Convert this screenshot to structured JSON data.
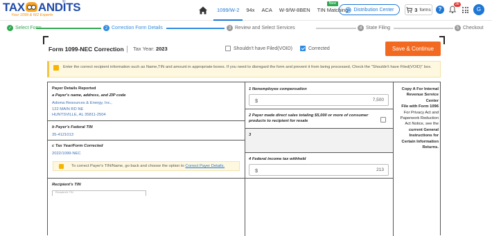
{
  "header": {
    "logo_text_left": "TAX",
    "logo_text_right": "ANDITS",
    "logo_reg": "®",
    "logo_tagline": "Your 1099 & W2 Experts",
    "nav": [
      {
        "label": "1099/W-2",
        "active": true
      },
      {
        "label": "94x"
      },
      {
        "label": "ACA"
      },
      {
        "label": "W-9/W-8BEN"
      },
      {
        "label": "TIN Matching",
        "badge": "New"
      }
    ],
    "distribution_label": "Distribution Center",
    "cart_count": "3",
    "cart_label": "forms",
    "help_label": "?",
    "bell_count": "36",
    "avatar_initial": "G"
  },
  "stepper": [
    {
      "num": "✓",
      "label": "Select Form",
      "state": "done"
    },
    {
      "num": "2",
      "label": "Correction Form Details",
      "state": "current"
    },
    {
      "num": "3",
      "label": "Review and Select Services",
      "state": "todo"
    },
    {
      "num": "4",
      "label": "State Filing",
      "state": "todo"
    },
    {
      "num": "5",
      "label": "Checkout",
      "state": "todo"
    }
  ],
  "form": {
    "title": "Form 1099-NEC Correction",
    "tax_year_label": "Tax Year:",
    "tax_year": "2023",
    "void_label": "Shouldn't have Filed(VOID)",
    "corrected_label": "Corrected",
    "save_label": "Save & Continue",
    "info_text": "Enter the correct recipient information such as Name,TIN and amount in appropriate boxes. If you need to disregard the form and prevent it from being processed, Check the \"Shouldn't have Filed(VOID)\" box."
  },
  "payer": {
    "section_label": "Payer Details Reported",
    "name_label": "a Payer's name, address, and ZIP code",
    "name": "Adoma Resources & Energy, Inc.,",
    "address1": "122 MAIN RD NE",
    "address2": "HUNTSVILLE, AL 35811-2504",
    "tin_label": "b Payer's Federal TIN",
    "tin": "35-4121013",
    "tax_year_form_label": "c Tax Year/Form Corrected",
    "tax_year_form": "2022/1099-NEC",
    "note_text": "To correct Payer's TIN/Name, go back and choose the option to",
    "note_link": "Correct Payer Details.",
    "recipient_tin_label": "Recipient's TIN",
    "recipient_tin_placeholder": "Recipient's TIN"
  },
  "boxes": {
    "box1_label": "1 Nonemployee compensation",
    "box1_currency": "$",
    "box1_amount": "7,500",
    "box2_label": "2 Payer made direct sales totaling $5,000 or more of consumer products to recipient for resale",
    "box3_label": "3",
    "box4_label": "4 Federal income tax withheld",
    "box4_currency": "$",
    "box4_amount": "213"
  },
  "copy_a": {
    "line1": "Copy A For Internal Revenue Service Center",
    "line2": "File with Form 1096",
    "line3": "For Privacy Act and Paperwork Reduction Act Notice, see the",
    "line4": "current General Instructions for Certain Information Returns."
  },
  "colors": {
    "brand_blue": "#1f77d4",
    "accent_orange": "#f26a21",
    "done_green": "#2fa84f"
  }
}
